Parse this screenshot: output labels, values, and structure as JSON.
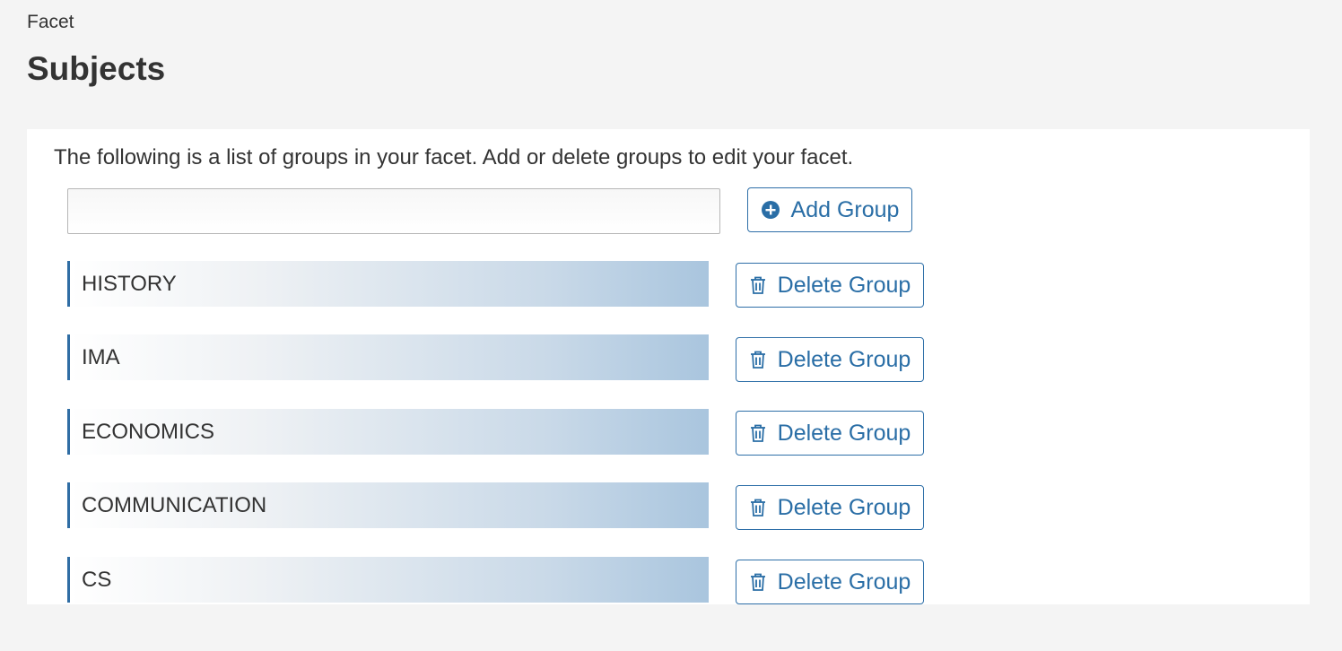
{
  "header": {
    "eyebrow": "Facet",
    "title": "Subjects"
  },
  "panel": {
    "intro": "The following is a list of groups in your facet. Add or delete groups to edit your facet.",
    "new_group_input": {
      "value": "",
      "placeholder": ""
    },
    "add_button_label": "Add Group",
    "groups": [
      {
        "name": "HISTORY",
        "delete_label": "Delete Group"
      },
      {
        "name": "IMA",
        "delete_label": "Delete Group"
      },
      {
        "name": "ECONOMICS",
        "delete_label": "Delete Group"
      },
      {
        "name": "COMMUNICATION",
        "delete_label": "Delete Group"
      },
      {
        "name": "CS",
        "delete_label": "Delete Group"
      }
    ]
  },
  "colors": {
    "accent": "#2a6ea6",
    "page_background": "#f4f4f4",
    "row_gradient_end": "#a9c5de"
  },
  "icons": {
    "add": "plus-circle-icon",
    "delete": "trash-icon"
  }
}
